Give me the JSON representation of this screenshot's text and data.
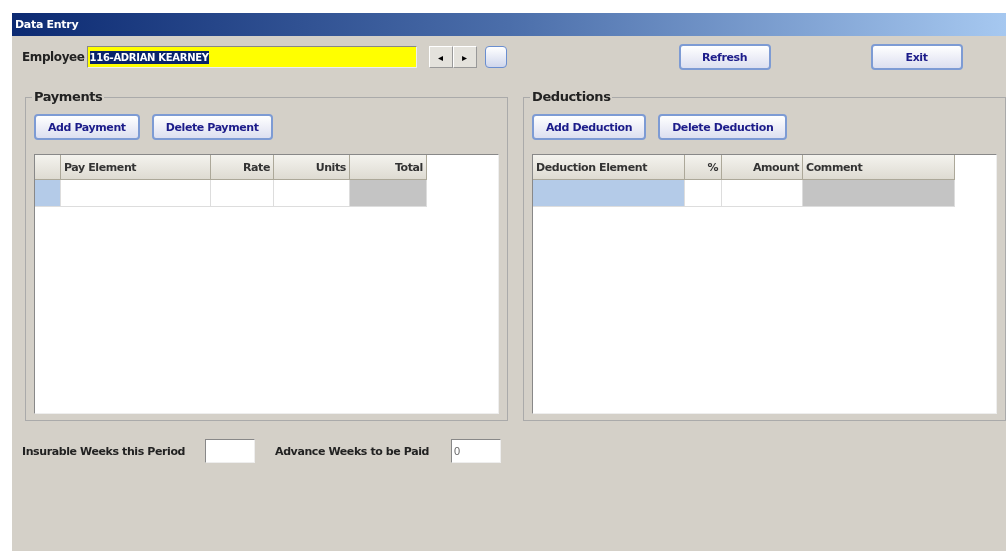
{
  "window": {
    "title": "Data Entry"
  },
  "employee": {
    "label": "Employee",
    "value": "116-ADRIAN KEARNEY"
  },
  "nav_buttons": [
    "◂",
    "▸"
  ],
  "top_buttons": [
    "Refresh",
    "Exit"
  ],
  "payments": {
    "title": "Payments",
    "buttons": [
      "Add Payment",
      "Delete Payment"
    ],
    "columns": [
      {
        "label": "Pay Element",
        "readonly": false
      },
      {
        "label": "Rate",
        "readonly": false
      },
      {
        "label": "Units",
        "readonly": false
      },
      {
        "label": "Total",
        "readonly": true
      }
    ],
    "rows": [
      {
        "selected": true
      }
    ]
  },
  "deductions": {
    "title": "Deductions",
    "buttons": [
      "Add Deduction",
      "Delete Deduction"
    ],
    "columns": [
      {
        "label": "Deduction Element",
        "readonly": false
      },
      {
        "label": "%",
        "readonly": false
      },
      {
        "label": "Amount",
        "readonly": false
      },
      {
        "label": "Comment",
        "readonly": true
      }
    ],
    "rows": [
      {
        "selected": true
      }
    ]
  },
  "footer": [
    {
      "label": "Insurable Weeks this Period"
    },
    {
      "label": "Advance Weeks to be Paid",
      "value": "0"
    }
  ]
}
